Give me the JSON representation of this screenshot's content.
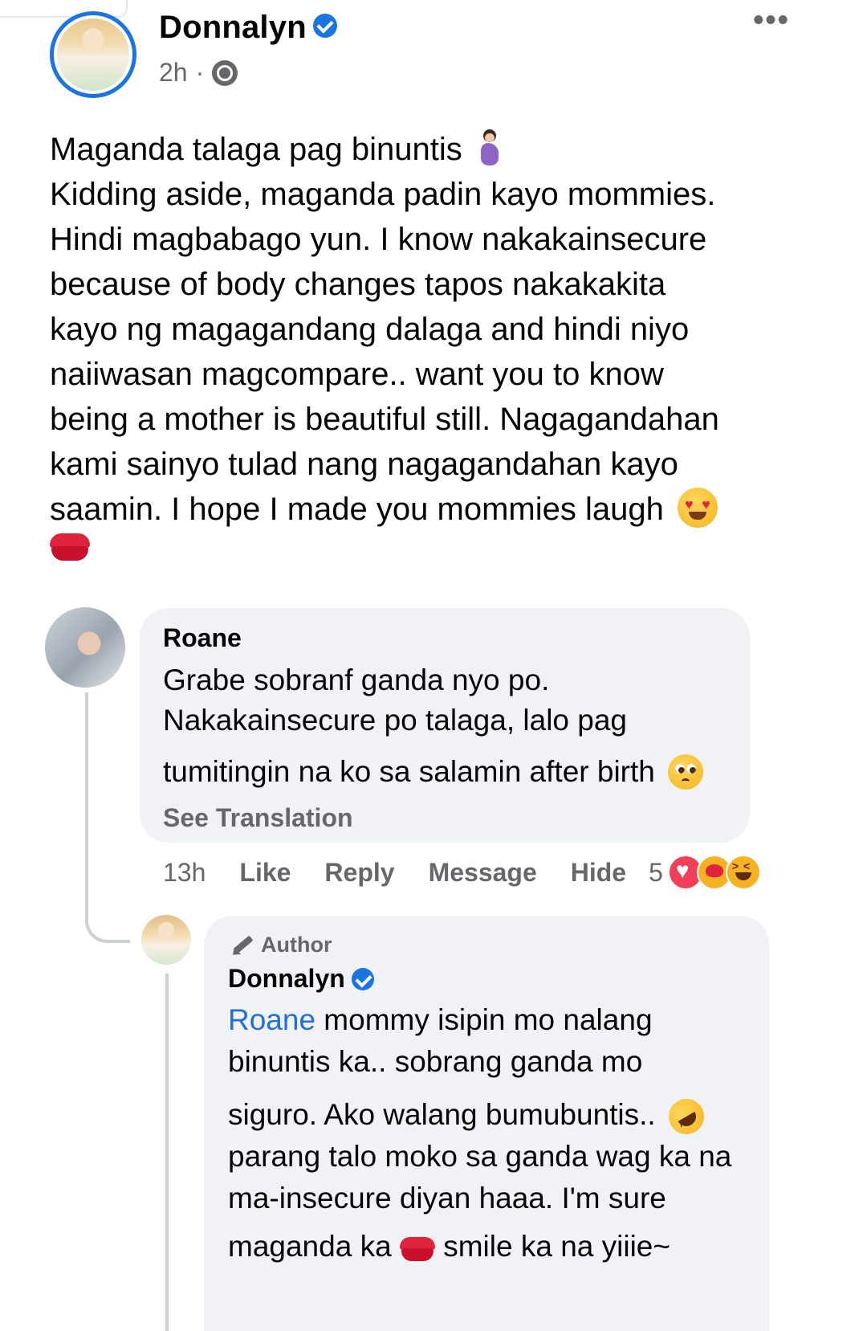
{
  "post": {
    "author": "Donnalyn",
    "time": "2h",
    "separator": "·",
    "more_label": "•••",
    "lines": [
      "Maganda talaga pag binuntis",
      "Kidding aside, maganda padin kayo mommies.",
      "Hindi magbabago yun. I know nakakainsecure",
      "because of body changes tapos nakakakita",
      "kayo ng magagandang dalaga and hindi niyo",
      "naiiwasan magcompare.. want you to know",
      "being a mother is beautiful still. Nagagandahan",
      "kami sainyo tulad nang nagagandahan kayo",
      "saamin. I hope I made you mommies laugh"
    ]
  },
  "comment": {
    "author": "Roane",
    "lines": [
      "Grabe sobranf ganda nyo po.",
      "Nakakainsecure po talaga, lalo pag",
      "tumitingin na ko sa salamin after birth"
    ],
    "see_translation": "See Translation",
    "actions": {
      "time": "13h",
      "like": "Like",
      "reply": "Reply",
      "message": "Message",
      "hide": "Hide",
      "reaction_count": "5"
    }
  },
  "reply": {
    "badge": "Author",
    "author": "Donnalyn",
    "mention": "Roane",
    "lines": [
      " mommy isipin mo nalang",
      "binuntis ka.. sobrang ganda mo",
      "siguro. Ako walang bumubuntis..",
      "parang talo moko sa ganda wag ka na",
      "ma-insecure diyan haaa. I'm sure",
      "maganda ka",
      " smile ka na yiiie~"
    ]
  }
}
